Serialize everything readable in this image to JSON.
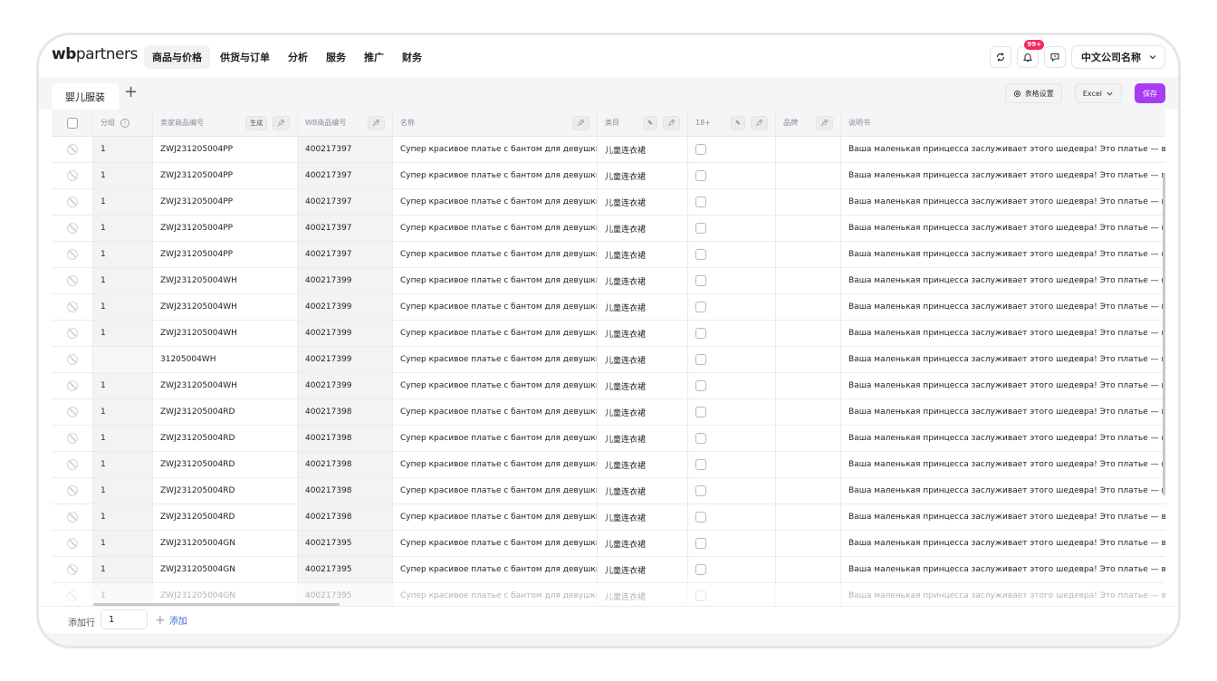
{
  "logo": {
    "part1": "wb",
    "part2": "partners"
  },
  "nav": [
    {
      "label": "商品与价格",
      "active": true
    },
    {
      "label": "供货与订单"
    },
    {
      "label": "分析"
    },
    {
      "label": "服务"
    },
    {
      "label": "推广"
    },
    {
      "label": "财务"
    }
  ],
  "notifications": {
    "badge": "99+"
  },
  "company": {
    "name": "中文公司名称"
  },
  "tabs": [
    {
      "label": "婴儿服装"
    }
  ],
  "toolbar": {
    "table_settings": "表格设置",
    "excel": "Excel",
    "save": "保存"
  },
  "columns": {
    "group": "分组",
    "seller_sku": "卖家商品编号",
    "generate": "生成",
    "wb_code": "WB商品编号",
    "name": "名称",
    "category": "类目",
    "age18": "18+",
    "brand": "品牌",
    "description": "说明书"
  },
  "rows": [
    {
      "group": "1",
      "sku": "ZWJ231205004PP",
      "wb": "400217397",
      "name": "Супер красивое платье с бантом для девушки",
      "category": "儿童连衣裙",
      "desc": "Ваша маленькая принцесса заслуживает этого шедевра! Это платье — воплощ"
    },
    {
      "group": "1",
      "sku": "ZWJ231205004PP",
      "wb": "400217397",
      "name": "Супер красивое платье с бантом для девушки",
      "category": "儿童连衣裙",
      "desc": "Ваша маленькая принцесса заслуживает этого шедевра! Это платье — воплощ"
    },
    {
      "group": "1",
      "sku": "ZWJ231205004PP",
      "wb": "400217397",
      "name": "Супер красивое платье с бантом для девушки",
      "category": "儿童连衣裙",
      "desc": "Ваша маленькая принцесса заслуживает этого шедевра! Это платье — воплощ"
    },
    {
      "group": "1",
      "sku": "ZWJ231205004PP",
      "wb": "400217397",
      "name": "Супер красивое платье с бантом для девушки",
      "category": "儿童连衣裙",
      "desc": "Ваша маленькая принцесса заслуживает этого шедевра! Это платье — воплощ"
    },
    {
      "group": "1",
      "sku": "ZWJ231205004PP",
      "wb": "400217397",
      "name": "Супер красивое платье с бантом для девушки",
      "category": "儿童连衣裙",
      "desc": "Ваша маленькая принцесса заслуживает этого шедевра! Это платье — воплощ"
    },
    {
      "group": "1",
      "sku": "ZWJ231205004WH",
      "wb": "400217399",
      "name": "Супер красивое платье с бантом для девушки",
      "category": "儿童连衣裙",
      "desc": "Ваша маленькая принцесса заслуживает этого шедевра! Это платье — воплощ"
    },
    {
      "group": "1",
      "sku": "ZWJ231205004WH",
      "wb": "400217399",
      "name": "Супер красивое платье с бантом для девушки",
      "category": "儿童连衣裙",
      "desc": "Ваша маленькая принцесса заслуживает этого шедевра! Это платье — воплощ"
    },
    {
      "group": "1",
      "sku": "ZWJ231205004WH",
      "wb": "400217399",
      "name": "Супер красивое платье с бантом для девушки",
      "category": "儿童连衣裙",
      "desc": "Ваша маленькая принцесса заслуживает этого шедевра! Это платье — воплощ"
    },
    {
      "group": "",
      "sku": "31205004WH",
      "wb": "400217399",
      "name": "Супер красивое платье с бантом для девушки",
      "category": "儿童连衣裙",
      "desc": "Ваша маленькая принцесса заслуживает этого шедевра! Это платье — воплощ"
    },
    {
      "group": "1",
      "sku": "ZWJ231205004WH",
      "wb": "400217399",
      "name": "Супер красивое платье с бантом для девушки",
      "category": "儿童连衣裙",
      "desc": "Ваша маленькая принцесса заслуживает этого шедевра! Это платье — воплощ"
    },
    {
      "group": "1",
      "sku": "ZWJ231205004RD",
      "wb": "400217398",
      "name": "Супер красивое платье с бантом для девушки",
      "category": "儿童连衣裙",
      "desc": "Ваша маленькая принцесса заслуживает этого шедевра! Это платье — воплощ"
    },
    {
      "group": "1",
      "sku": "ZWJ231205004RD",
      "wb": "400217398",
      "name": "Супер красивое платье с бантом для девушки",
      "category": "儿童连衣裙",
      "desc": "Ваша маленькая принцесса заслуживает этого шедевра! Это платье — воплощ"
    },
    {
      "group": "1",
      "sku": "ZWJ231205004RD",
      "wb": "400217398",
      "name": "Супер красивое платье с бантом для девушки",
      "category": "儿童连衣裙",
      "desc": "Ваша маленькая принцесса заслуживает этого шедевра! Это платье — воплощ"
    },
    {
      "group": "1",
      "sku": "ZWJ231205004RD",
      "wb": "400217398",
      "name": "Супер красивое платье с бантом для девушки",
      "category": "儿童连衣裙",
      "desc": "Ваша маленькая принцесса заслуживает этого шедевра! Это платье — воплощ"
    },
    {
      "group": "1",
      "sku": "ZWJ231205004RD",
      "wb": "400217398",
      "name": "Супер красивое платье с бантом для девушки",
      "category": "儿童连衣裙",
      "desc": "Ваша маленькая принцесса заслуживает этого шедевра! Это платье — воплощ"
    },
    {
      "group": "1",
      "sku": "ZWJ231205004GN",
      "wb": "400217395",
      "name": "Супер красивое платье с бантом для девушки",
      "category": "儿童连衣裙",
      "desc": "Ваша маленькая принцесса заслуживает этого шедевра! Это платье — воплощ"
    },
    {
      "group": "1",
      "sku": "ZWJ231205004GN",
      "wb": "400217395",
      "name": "Супер красивое платье с бантом для девушки",
      "category": "儿童连衣裙",
      "desc": "Ваша маленькая принцесса заслуживает этого шедевра! Это платье — воплощ"
    },
    {
      "group": "1",
      "sku": "ZWJ231205004GN",
      "wb": "400217395",
      "name": "Супер красивое платье с бантом для девушки",
      "category": "儿童连衣裙",
      "desc": "Ваша маленькая принцесса заслуживает этого шедевра! Это платье — воплощ"
    }
  ],
  "footer": {
    "add_rows_label": "添加行",
    "add_rows_value": "1",
    "add_button": "添加"
  },
  "colors": {
    "accent": "#a83cf5",
    "badge": "#f02d5a",
    "link": "#3b6fd4"
  }
}
